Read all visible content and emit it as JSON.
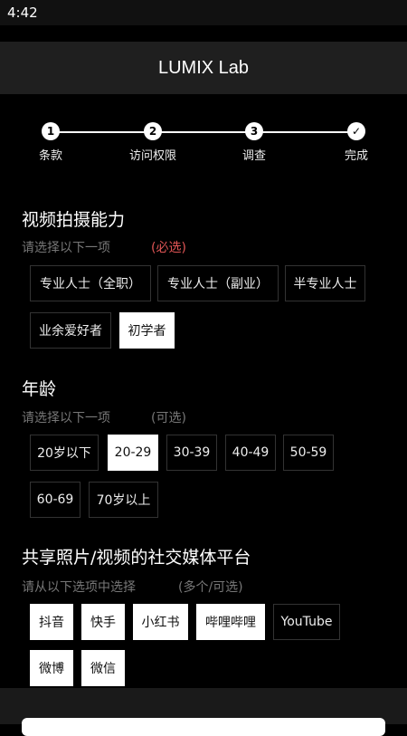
{
  "status": {
    "time": "4:42"
  },
  "app": {
    "title": "LUMIX Lab"
  },
  "stepper": {
    "steps": [
      {
        "num": "1",
        "label": "条款"
      },
      {
        "num": "2",
        "label": "访问权限"
      },
      {
        "num": "3",
        "label": "调查"
      },
      {
        "num": "✓",
        "label": "完成"
      }
    ]
  },
  "section1": {
    "title": "视频拍摄能力",
    "hint": "请选择以下一项",
    "tag": "(必选)",
    "tag_color": "#e05555",
    "options": [
      "专业人士（全职）",
      "专业人士（副业）",
      "半专业人士",
      "业余爱好者",
      "初学者"
    ],
    "selected": "初学者"
  },
  "section2": {
    "title": "年龄",
    "hint": "请选择以下一项",
    "tag": "(可选)",
    "options": [
      "20岁以下",
      "20-29",
      "30-39",
      "40-49",
      "50-59",
      "60-69",
      "70岁以上"
    ],
    "selected": "20-29"
  },
  "section3": {
    "title": "共享照片/视频的社交媒体平台",
    "hint": "请从以下选项中选择",
    "tag": "(多个/可选)",
    "options": [
      "抖音",
      "快手",
      "小红书",
      "哔哩哔哩",
      "YouTube",
      "微博",
      "微信"
    ],
    "selected": [
      "抖音",
      "快手",
      "小红书",
      "哔哩哔哩",
      "微博",
      "微信"
    ]
  }
}
